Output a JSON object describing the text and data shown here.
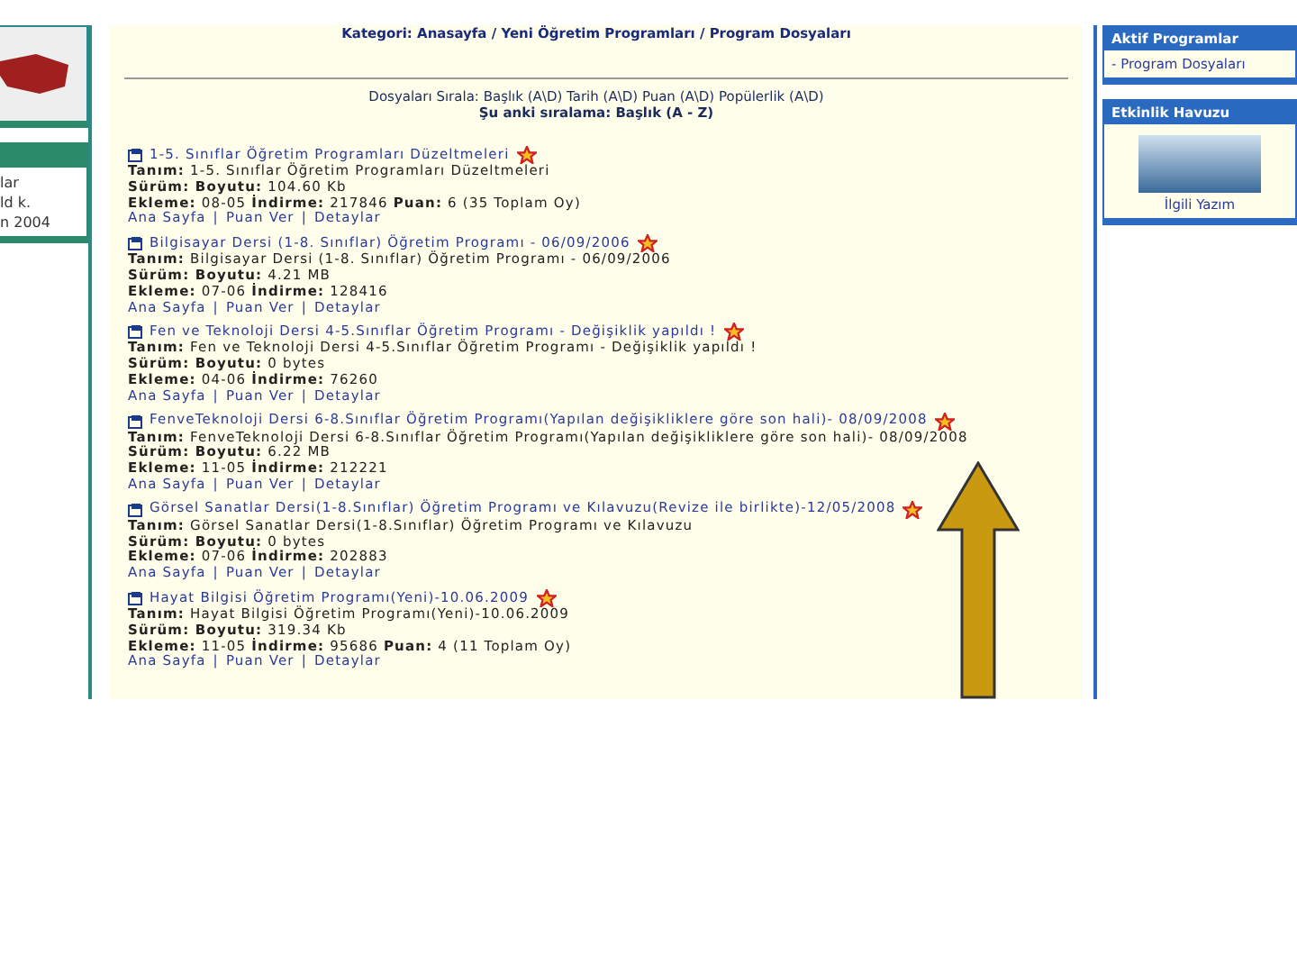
{
  "left_panel": {
    "lines": [
      "lar",
      "ld k.",
      "n 2004"
    ]
  },
  "breadcrumb": "Kategori: Anasayfa / Yeni Öğretim Programları / Program Dosyaları",
  "sort_options": "Dosyaları Sırala: Başlık (A\\D) Tarih (A\\D) Puan (A\\D) Popülerlik (A\\D)",
  "current_sort": "Şu anki sıralama: Başlık (A - Z)",
  "link_separator": "|",
  "files": [
    {
      "title": "1-5. Sınıflar Öğretim Programları Düzeltmeleri",
      "lines": [
        "**Tanım:** 1-5. Sınıflar Öğretim Programları Düzeltmeleri",
        "**Sürüm: Boyutu:** 104.60 Kb",
        "**Ekleme:** 08-05 **İndirme:** 217846 **Puan:** 6 (35 Toplam Oy)"
      ],
      "links": [
        "Ana Sayfa",
        "Puan Ver",
        "Detaylar"
      ]
    },
    {
      "title": "Bilgisayar Dersi (1-8. Sınıflar) Öğretim Programı - 06/09/2006",
      "lines": [
        "**Tanım:** Bilgisayar Dersi (1-8. Sınıflar) Öğretim Programı - 06/09/2006",
        "**Sürüm: Boyutu:** 4.21 MB",
        "**Ekleme:** 07-06 **İndirme:** 128416"
      ],
      "links": [
        "Ana Sayfa",
        "Puan Ver",
        "Detaylar"
      ]
    },
    {
      "title": "Fen ve Teknoloji Dersi 4-5.Sınıflar Öğretim Programı - Değişiklik yapıldı !",
      "lines": [
        "**Tanım:** Fen ve Teknoloji Dersi 4-5.Sınıflar Öğretim Programı - Değişiklik yapıldı !",
        "**Sürüm: Boyutu:** 0 bytes",
        "**Ekleme:** 04-06 **İndirme:** 76260"
      ],
      "links": [
        "Ana Sayfa",
        "Puan Ver",
        "Detaylar"
      ]
    },
    {
      "title": "FenveTeknoloji Dersi 6-8.Sınıflar Öğretim Programı(Yapılan değişikliklere göre son hali)- 08/09/2008",
      "lines": [
        "**Tanım:** FenveTeknoloji Dersi 6-8.Sınıflar Öğretim Programı(Yapılan değişikliklere göre son hali)- 08/09/2008",
        "**Sürüm: Boyutu:** 6.22 MB",
        "**Ekleme:** 11-05 **İndirme:** 212221"
      ],
      "links": [
        "Ana Sayfa",
        "Puan Ver",
        "Detaylar"
      ]
    },
    {
      "title": "Görsel Sanatlar Dersi(1-8.Sınıflar) Öğretim Programı ve Kılavuzu(Revize ile birlikte)-12/05/2008",
      "lines": [
        "**Tanım:** Görsel Sanatlar Dersi(1-8.Sınıflar) Öğretim Programı ve Kılavuzu",
        "**Sürüm: Boyutu:** 0 bytes",
        "**Ekleme:** 07-06 **İndirme:** 202883"
      ],
      "links": [
        "Ana Sayfa",
        "Puan Ver",
        "Detaylar"
      ]
    },
    {
      "title": "Hayat Bilgisi Öğretim Programı(Yeni)-10.06.2009",
      "lines": [
        "**Tanım:** Hayat Bilgisi Öğretim Programı(Yeni)-10.06.2009",
        "**Sürüm: Boyutu:** 319.34 Kb",
        "**Ekleme:** 11-05 **İndirme:** 95686 **Puan:** 4 (11 Toplam Oy)"
      ],
      "links": [
        "Ana Sayfa",
        "Puan Ver",
        "Detaylar"
      ]
    }
  ],
  "right_panel": {
    "boxes": [
      {
        "kind": "links",
        "header": "Aktif Programlar",
        "items": [
          "- Program Dosyaları"
        ]
      },
      {
        "kind": "photo",
        "header": "Etkinlik Havuzu",
        "caption": "İlgili Yazım"
      }
    ]
  }
}
